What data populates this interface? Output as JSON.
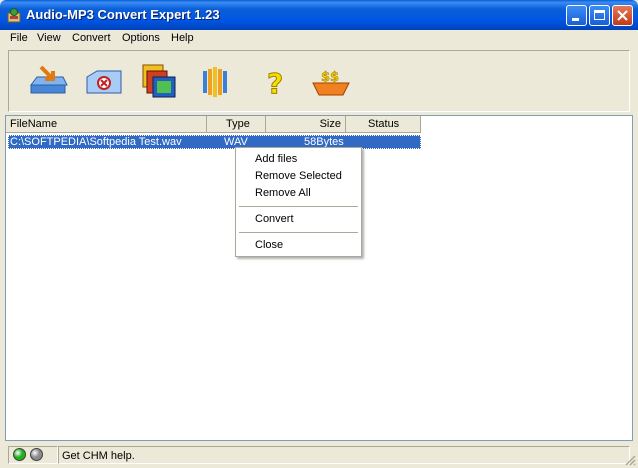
{
  "window": {
    "title": "Audio-MP3 Convert Expert 1.23",
    "colors": {
      "titlebar": "#0054e3",
      "selection": "#316ac5",
      "face": "#ece9d8"
    }
  },
  "menu": [
    "File",
    "View",
    "Convert",
    "Options",
    "Help"
  ],
  "toolbar": {
    "buttons": [
      {
        "name": "add-files",
        "icon": "folder-arrow-icon"
      },
      {
        "name": "remove",
        "icon": "remove-file-icon"
      },
      {
        "name": "convert",
        "icon": "convert-stack-icon"
      },
      {
        "name": "options",
        "icon": "audio-options-icon"
      },
      {
        "name": "help",
        "icon": "question-mark-icon"
      },
      {
        "name": "buy",
        "icon": "dollar-basket-icon"
      }
    ]
  },
  "list": {
    "columns": [
      "FileName",
      "Type",
      "Size",
      "Status"
    ],
    "rows": [
      {
        "filename": "C:\\SOFTPEDIA\\Softpedia Test.wav",
        "type": "WAV",
        "size": "58Bytes",
        "status": ""
      }
    ]
  },
  "context_menu": {
    "items": [
      "Add files",
      "Remove Selected",
      "Remove All",
      "Convert",
      "Close"
    ]
  },
  "status": {
    "text": "Get CHM help.",
    "leds": [
      "#1fb01f",
      "#8a8a8a"
    ]
  }
}
